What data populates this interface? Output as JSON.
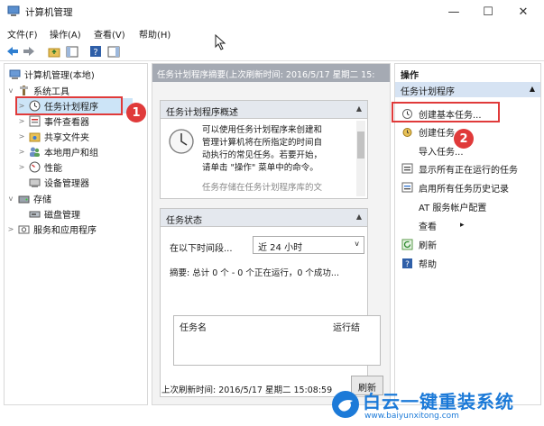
{
  "window": {
    "title": "计算机管理",
    "minimize": "—",
    "maximize": "☐",
    "close": "✕"
  },
  "menu": [
    "文件(F)",
    "操作(A)",
    "查看(V)",
    "帮助(H)"
  ],
  "tree": {
    "root": "计算机管理(本地)",
    "system_tools": "系统工具",
    "task_scheduler": "任务计划程序",
    "event_viewer": "事件查看器",
    "shared_folders": "共享文件夹",
    "local_users": "本地用户和组",
    "performance": "性能",
    "device_manager": "设备管理器",
    "storage": "存储",
    "disk_management": "磁盘管理",
    "services_apps": "服务和应用程序"
  },
  "center": {
    "header": "任务计划程序摘要(上次刷新时间: 2016/5/17 星期二 15:",
    "overview_title": "任务计划程序概述",
    "overview_text": [
      "可以使用任务计划程序来创建和",
      "管理计算机将在所指定的时间自",
      "动执行的常见任务。若要开始，",
      "请单击 \"操作\" 菜单中的命令。"
    ],
    "overview_cut": "任务存储在任务计划程序库的文",
    "status_title": "任务状态",
    "period_label": "在以下时间段...",
    "period_value": "近 24 小时",
    "summary": "摘要: 总计 0 个 - 0 个正在运行，0 个成功...",
    "col_task": "任务名",
    "col_result": "运行结",
    "last_refresh": "上次刷新时间: 2016/5/17 星期二 15:08:59",
    "refresh_button": "刷新"
  },
  "actions": {
    "header": "操作",
    "section": "任务计划程序",
    "items": [
      "创建基本任务...",
      "创建任务...",
      "导入任务...",
      "显示所有正在运行的任务",
      "启用所有任务历史记录",
      "AT 服务帐户配置",
      "查看",
      "刷新",
      "帮助"
    ]
  },
  "badges": [
    "1",
    "2"
  ],
  "watermark": {
    "title": "白云一键重装系统",
    "url": "www.baiyunxitong.com"
  },
  "colors": {
    "accent": "#1c7ad8",
    "callout": "#e03a3a",
    "selection": "#cce4f7",
    "header_bar": "#a5aab3"
  }
}
